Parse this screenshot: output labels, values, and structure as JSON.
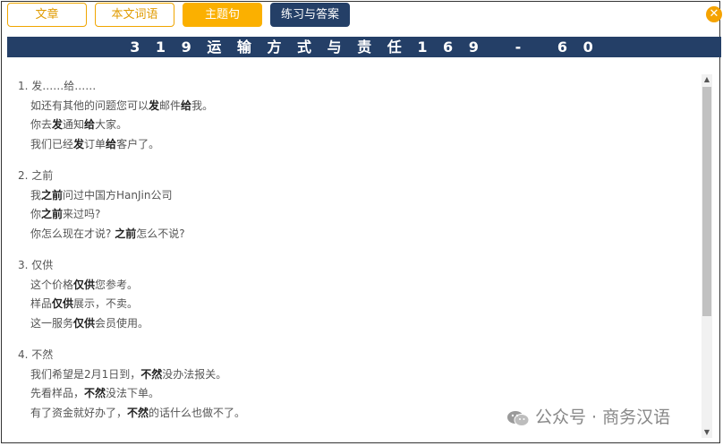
{
  "tabs": [
    {
      "label": "文章"
    },
    {
      "label": "本文词语"
    },
    {
      "label": "主题句"
    },
    {
      "label": "练习与答案"
    }
  ],
  "close_icon": "close-icon",
  "title": "3 1 9 运 输 方 式 与 责 任 1 6 9   -   6 0",
  "sections": [
    {
      "heading": "1. 发……给……",
      "lines": [
        [
          {
            "t": "如还有其他的问题您可以"
          },
          {
            "t": "发",
            "b": true
          },
          {
            "t": "邮件"
          },
          {
            "t": "给",
            "b": true
          },
          {
            "t": "我。"
          }
        ],
        [
          {
            "t": "你去"
          },
          {
            "t": "发",
            "b": true
          },
          {
            "t": "通知"
          },
          {
            "t": "给",
            "b": true
          },
          {
            "t": "大家。"
          }
        ],
        [
          {
            "t": "我们已经"
          },
          {
            "t": "发",
            "b": true
          },
          {
            "t": "订单"
          },
          {
            "t": "给",
            "b": true
          },
          {
            "t": "客户了。"
          }
        ]
      ]
    },
    {
      "heading": "2. 之前",
      "lines": [
        [
          {
            "t": "我"
          },
          {
            "t": "之前",
            "b": true
          },
          {
            "t": "问过中国方HanJin公司"
          }
        ],
        [
          {
            "t": "你"
          },
          {
            "t": "之前",
            "b": true
          },
          {
            "t": "来过吗?"
          }
        ],
        [
          {
            "t": "你怎么现在才说? "
          },
          {
            "t": "之前",
            "b": true
          },
          {
            "t": "怎么不说?"
          }
        ]
      ]
    },
    {
      "heading": "3. 仅供",
      "lines": [
        [
          {
            "t": "这个价格"
          },
          {
            "t": "仅供",
            "b": true
          },
          {
            "t": "您参考。"
          }
        ],
        [
          {
            "t": "样品"
          },
          {
            "t": "仅供",
            "b": true
          },
          {
            "t": "展示，不卖。"
          }
        ],
        [
          {
            "t": "这一服务"
          },
          {
            "t": "仅供",
            "b": true
          },
          {
            "t": "会员使用。"
          }
        ]
      ]
    },
    {
      "heading": "4. 不然",
      "lines": [
        [
          {
            "t": "我们希望是2月1日到，"
          },
          {
            "t": "不然",
            "b": true
          },
          {
            "t": "没办法报关。"
          }
        ],
        [
          {
            "t": "先看样品，"
          },
          {
            "t": "不然",
            "b": true
          },
          {
            "t": "没法下单。"
          }
        ],
        [
          {
            "t": "有了资金就好办了，"
          },
          {
            "t": "不然",
            "b": true
          },
          {
            "t": "的话什么也做不了。"
          }
        ]
      ]
    }
  ],
  "watermark": "公众号 · 商务汉语"
}
